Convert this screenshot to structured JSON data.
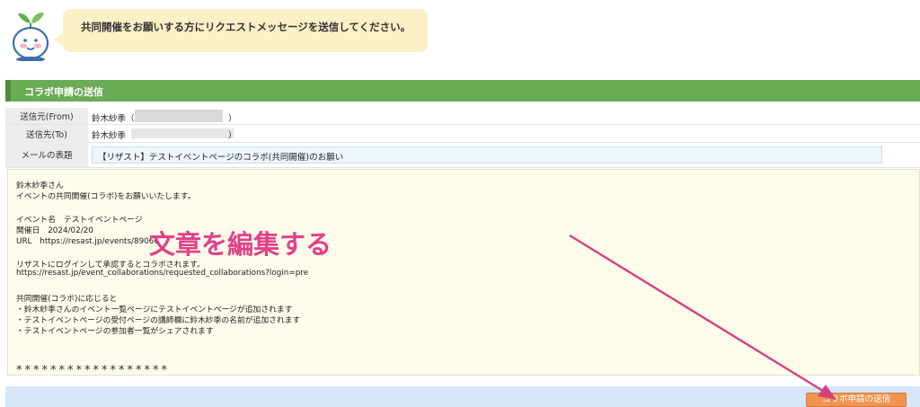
{
  "banner": {
    "message": "共同開催をお願いする方にリクエストメッセージを送信してください。",
    "mascot_icon": "sprout-mascot-icon"
  },
  "section": {
    "title": "コラボ申請の送信"
  },
  "form": {
    "from_label": "送信元(From)",
    "from_value": "鈴木紗季（",
    "from_close": "）",
    "to_label": "送信先(To)",
    "to_value": "鈴木紗季（",
    "to_close": "）",
    "subject_label": "メールの表題",
    "subject_value": "【リザスト】テストイベントページのコラボ(共同開催)のお願い"
  },
  "message": {
    "lines": [
      "鈴木紗季さん",
      "イベントの共同開催(コラボ)をお願いいたします。",
      "",
      "イベント名　テストイベントページ",
      "開催日　2024/02/20",
      "URL　https://resast.jp/events/89066",
      "",
      "リザストにログインして承認するとコラボされます。",
      "https://resast.jp/event_collaborations/requested_collaborations?login=pre",
      "",
      "共同開催(コラボ)に応じると",
      "・鈴木紗季さんのイベント一覧ページにテストイベントページが追加されます",
      "・テストイベントページの受付ページの講師欄に鈴木紗季の名前が追加されます",
      "・テストイベントページの参加者一覧がシェアされます"
    ],
    "stars": "******************"
  },
  "annotation": {
    "text": "文章を編集する"
  },
  "actions": {
    "send_label": "コラボ申請の送信"
  },
  "colors": {
    "accent_green": "#6aab55",
    "bubble": "#fbf0c6",
    "annotation_pink": "#e0418a",
    "button_orange": "#ef9550",
    "bottom_band": "#d7e5f9"
  }
}
